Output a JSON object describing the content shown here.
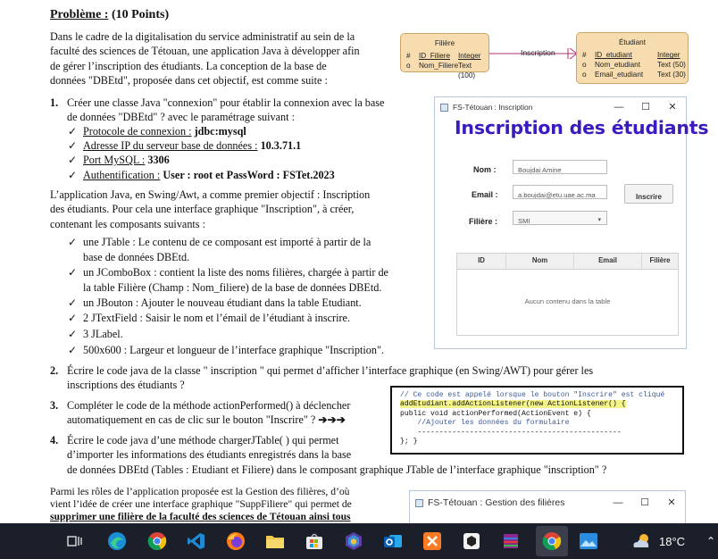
{
  "doc": {
    "title_u": "Problème :",
    "title_rest": " (10 Points)",
    "intro": [
      "Dans le cadre de la digitalisation du service administratif au sein de la",
      "faculté des sciences de Tétouan, une application Java à développer afin",
      "de gérer l’inscription des étudiants. La conception de la base de",
      "données \"DBEtd\", proposée dans cet objectif, est comme suite :"
    ],
    "q1": {
      "num": "1.",
      "l1": "Créer une classe Java \"connexion\" pour établir la connexion avec la base",
      "l2": "de données \"DBEtd\" ? avec le paramétrage suivant :",
      "items": [
        {
          "k": "Protocole de connexion :",
          "v": " jdbc:mysql"
        },
        {
          "k": "Adresse IP du serveur base de données :",
          "v": " 10.3.71.1"
        },
        {
          "k": "Port MySQL :",
          "v": " 3306"
        },
        {
          "k": "Authentification :",
          "v": " User : root et PassWord : FSTet.2023"
        }
      ]
    },
    "app": [
      "L’application Java, en Swing/Awt, a comme premier objectif : Inscription",
      "des étudiants. Pour cela une interface graphique \"Inscription\", à créer,",
      "contenant les composants suivants :"
    ],
    "comps": [
      "une JTable : Le contenu de ce composant est importé à partir de la",
      "base de données DBEtd.",
      "un JComboBox : contient la liste des noms filières, chargée à partir de",
      "la table Filière (Champ : Nom_filiere) de la base de données DBEtd.",
      "un JBouton : Ajouter le nouveau étudiant dans la table Etudiant.",
      "2 JTextField : Saisir le nom et l’émail de l’étudiant à inscrire.",
      "3 JLabel.",
      "500x600 : Largeur et longueur de l’interface graphique \"Inscription\"."
    ],
    "q2": {
      "num": "2.",
      "l1": "Écrire le code java de la classe \" inscription \" qui permet d’afficher l’interface graphique (en Swing/AWT) pour gérer les",
      "l2": "inscriptions des étudiants ?"
    },
    "q3": {
      "num": "3.",
      "l1": "Compléter le code de la méthode actionPerformed() à déclencher",
      "l2": "automatiquement en cas de clic sur le bouton \"Inscrire\" ?",
      "arrows": "➔➔➔"
    },
    "q4": {
      "num": "4.",
      "l1": "Écrire le code java d’une méthode chargerJTable( ) qui permet",
      "l2": "d’importer les informations des étudiants enregistrés dans la base",
      "l3": "de données DBEtd (Tables : Etudiant et Filiere) dans le composant graphique JTable de l’interface graphique \"inscription\" ?"
    },
    "last": [
      "Parmi les rôles de l’application proposée est la Gestion des filières, d’où",
      "vient l’idée de créer une interface graphique \"SuppFiliere\" qui permet de",
      "supprimer une filière de la faculté des sciences de Tétouan ainsi tous"
    ]
  },
  "er": {
    "filiere": {
      "title": "Filière",
      "rows": [
        {
          "a": "#",
          "n": "ID_Filiere",
          "t": "Integer"
        },
        {
          "a": "o",
          "n": "Nom_Filiere",
          "t": "Text (100)"
        }
      ]
    },
    "etudiant": {
      "title": "Étudiant",
      "rows": [
        {
          "a": "#",
          "n": "ID_etudiant",
          "t": "Integer"
        },
        {
          "a": "o",
          "n": "Nom_etudiant",
          "t": "Text (50)"
        },
        {
          "a": "o",
          "n": "Email_etudiant",
          "t": "Text (30)"
        }
      ]
    },
    "relation": "Inscription"
  },
  "win1": {
    "title": "FS-Tétouan : Inscription",
    "heading": "Inscription des étudiants",
    "nom_label": "Nom :",
    "nom_value": "Boujdai Amine",
    "email_label": "Email :",
    "email_value": "a.boujdai@etu.uae.ac.ma",
    "filiere_label": "Filière :",
    "filiere_value": "SMI",
    "button": "Inscrire",
    "columns": [
      "ID",
      "Nom",
      "Email",
      "Filière"
    ],
    "empty": "Aucun contenu dans la table"
  },
  "code": [
    "// Ce code est appelé lorsque le bouton \"Inscrire\" est cliqué",
    "addEtudiant.addActionListener(new ActionListener() {",
    "public void actionPerformed(ActionEvent e) {",
    "    //Ajouter les données du formulaire",
    "    -----------------------------------------------",
    "}; }"
  ],
  "win2": {
    "title": "FS-Tétouan : Gestion des filiéres"
  },
  "taskbar": {
    "temp": "18°C",
    "colors": {
      "bg": "#1b1f2a"
    }
  }
}
